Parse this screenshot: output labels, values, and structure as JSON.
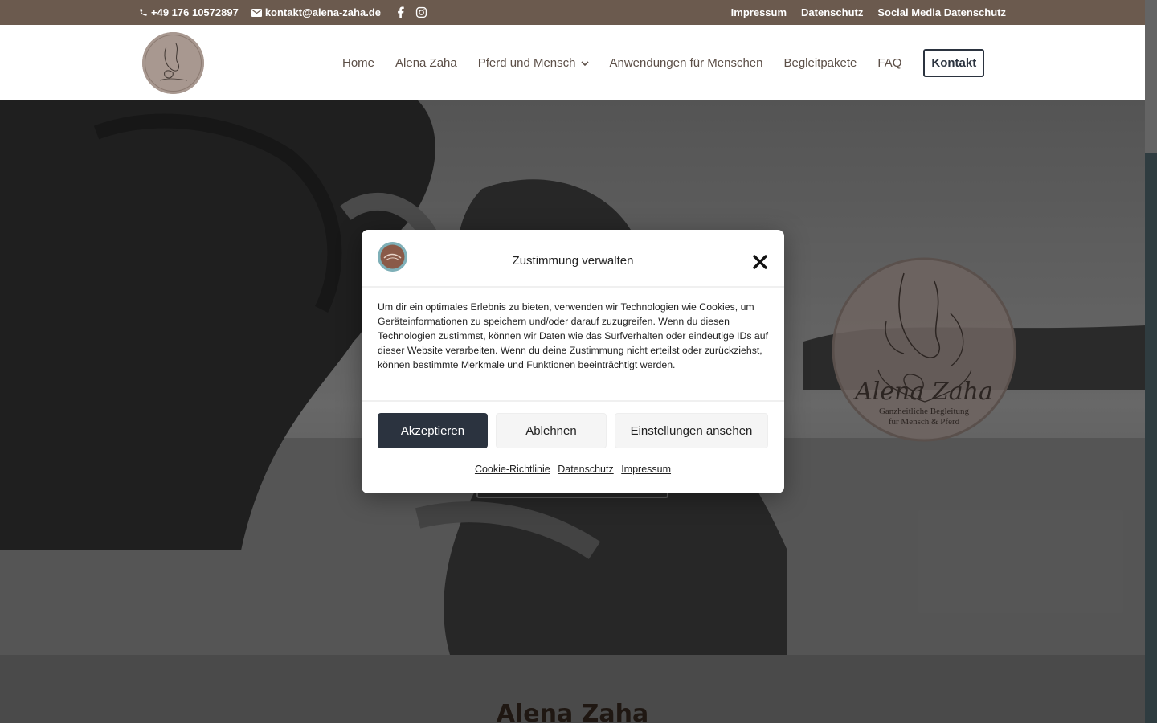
{
  "topbar": {
    "phone": "+49 176 10572897",
    "email": "kontakt@alena-zaha.de",
    "links": [
      "Impressum",
      "Datenschutz",
      "Social Media Datenschutz"
    ]
  },
  "nav": {
    "items": [
      "Home",
      "Alena Zaha",
      "Pferd und Mensch",
      "Anwendungen für Menschen",
      "Begleitpakete",
      "FAQ"
    ],
    "cta": "Kontakt"
  },
  "hero": {
    "logo_script": "Alena Zaha",
    "logo_line1": "Ganzheitliche Begleitung",
    "logo_line2": "für Mensch & Pferd"
  },
  "section2": {
    "heading": "Alena Zaha"
  },
  "modal": {
    "title": "Zustimmung verwalten",
    "body": "Um dir ein optimales Erlebnis zu bieten, verwenden wir Technologien wie Cookies, um Geräteinformationen zu speichern und/oder darauf zuzugreifen. Wenn du diesen Technologien zustimmst, können wir Daten wie das Surfverhalten oder eindeutige IDs auf dieser Website verarbeiten. Wenn du deine Zustimmung nicht erteilst oder zurückziehst, können bestimmte Merkmale und Funktionen beeinträchtigt werden.",
    "accept": "Akzeptieren",
    "deny": "Ablehnen",
    "settings": "Einstellungen ansehen",
    "links": [
      "Cookie-Richtlinie",
      "Datenschutz",
      "Impressum"
    ]
  },
  "colors": {
    "topbar": "#6b5a4e",
    "accent_dark": "#2b333f",
    "nav_text": "#5c4f47"
  }
}
